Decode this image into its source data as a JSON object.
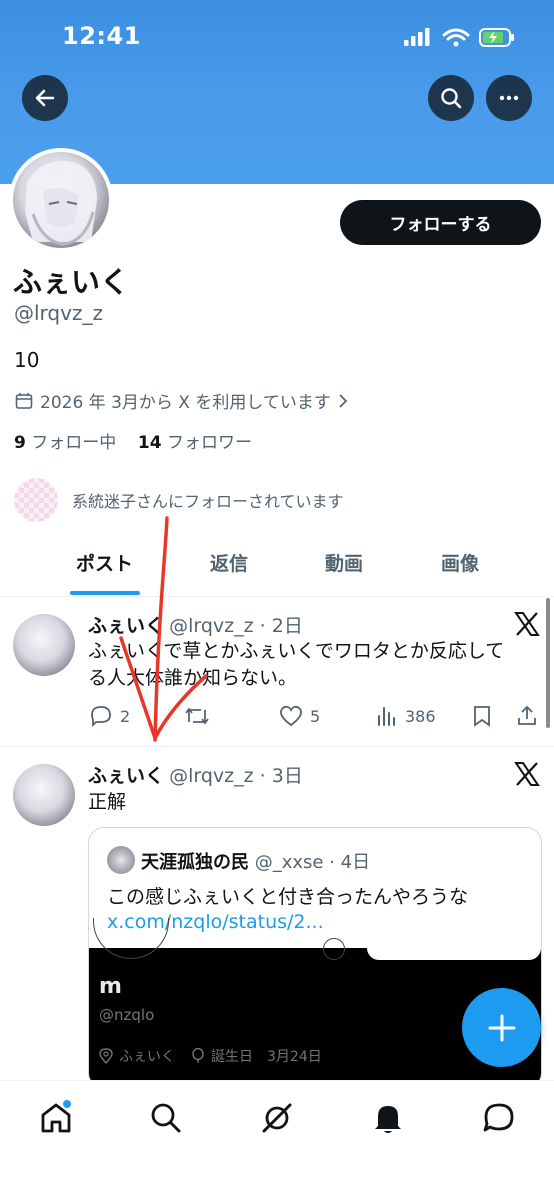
{
  "status_bar": {
    "time": "12:41"
  },
  "header": {
    "back_icon": "arrow-left-icon",
    "search_icon": "search-icon",
    "more_icon": "more-icon"
  },
  "profile": {
    "follow_label": "フォローする",
    "display_name": "ふぇいく",
    "handle": "@lrqvz_z",
    "bio": "10",
    "joined": "2026 年 3月から X を利用しています",
    "following_count": "9",
    "following_label": "フォロー中",
    "followers_count": "14",
    "followers_label": "フォロワー",
    "followed_by_text": "系統迷子さんにフォローされています"
  },
  "tabs": [
    {
      "label": "ポスト",
      "active": true
    },
    {
      "label": "返信",
      "active": false
    },
    {
      "label": "動画",
      "active": false
    },
    {
      "label": "画像",
      "active": false
    }
  ],
  "posts": [
    {
      "name": "ふぇいく",
      "meta": "@lrqvz_z · 2日",
      "text_line1": "ふぇいくで草とかふぇいくでワロタとか反応して",
      "text_line2": "る人大体誰か知らない。",
      "replies": "2",
      "likes": "5",
      "views": "386"
    },
    {
      "name": "ふぇいく",
      "meta": "@lrqvz_z · 3日",
      "text": "正解",
      "quote": {
        "name": "天涯孤独の民",
        "meta": "@_xxse · 4日",
        "text": "この感じふぇいくと付き合ったんやろうな",
        "link": "x.com/nzqlo/status/2...",
        "embedded_name": "m",
        "embedded_handle": "@nzqlo",
        "embedded_location": "ふぇいく",
        "embedded_birthday_label": "誕生日",
        "embedded_birthday": "3月24日"
      }
    }
  ],
  "colors": {
    "accent": "#1d9bf0",
    "banner": "#4a9ceb",
    "annotation": "#e8362a"
  }
}
